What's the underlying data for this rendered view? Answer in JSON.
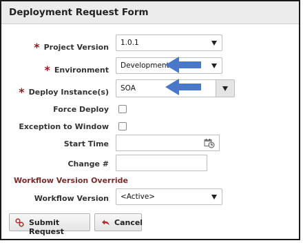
{
  "form": {
    "title": "Deployment Request Form",
    "project_version": {
      "label": "Project Version",
      "required": "*",
      "value": "1.0.1"
    },
    "environment": {
      "label": "Environment",
      "required": "*",
      "value": "Development"
    },
    "deploy_instances": {
      "label": "Deploy Instance(s)",
      "required": "*",
      "value": "SOA"
    },
    "force_deploy": {
      "label": "Force Deploy",
      "checked": false
    },
    "exception_to_window": {
      "label": "Exception to Window",
      "checked": false
    },
    "start_time": {
      "label": "Start Time",
      "value": ""
    },
    "change_number": {
      "label": "Change #",
      "value": ""
    },
    "workflow_override_section": "Workflow Version Override",
    "workflow_version": {
      "label": "Workflow Version",
      "value": "<Active>"
    },
    "buttons": {
      "submit": "Submit Request",
      "cancel": "Cancel"
    }
  },
  "icons": {
    "submit": "workflow-icon",
    "cancel": "undo-icon",
    "calendar": "calendar-clock-icon",
    "annotation_arrow": "blue-arrow-icon"
  },
  "colors": {
    "required": "#8b1a1a",
    "section": "#7a2a2a",
    "annotation_arrow": "#4a78c8"
  }
}
